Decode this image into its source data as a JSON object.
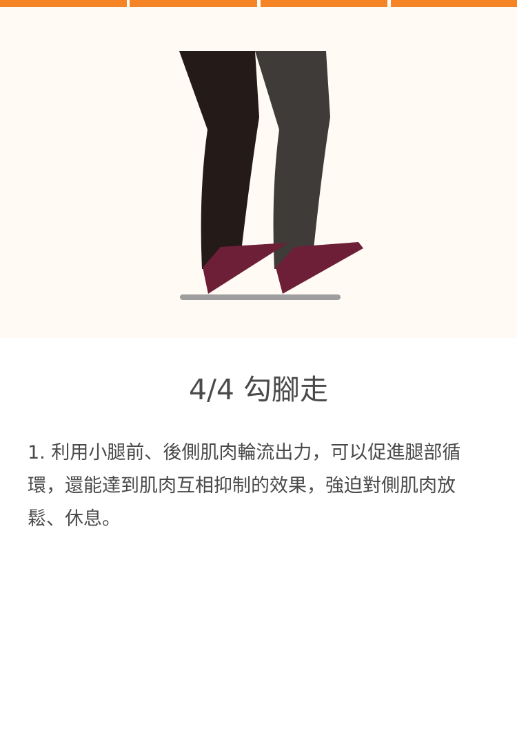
{
  "progress": {
    "total_steps": 4,
    "current_step": 4,
    "color": "#f48426"
  },
  "illustration": {
    "icon": "legs-flexed-feet-walking-illustration",
    "background_color": "#fffaf3",
    "colors": {
      "front_leg": "#241a18",
      "back_leg": "#3e3b39",
      "shoes": "#6d1f38",
      "floor": "#9e9e9e"
    }
  },
  "step": {
    "title": "4/4 勾腳走",
    "description": "1. 利用小腿前、後側肌肉輪流出力，可以促進腿部循環，還能達到肌肉互相抑制的效果，強迫對側肌肉放鬆、休息。"
  }
}
